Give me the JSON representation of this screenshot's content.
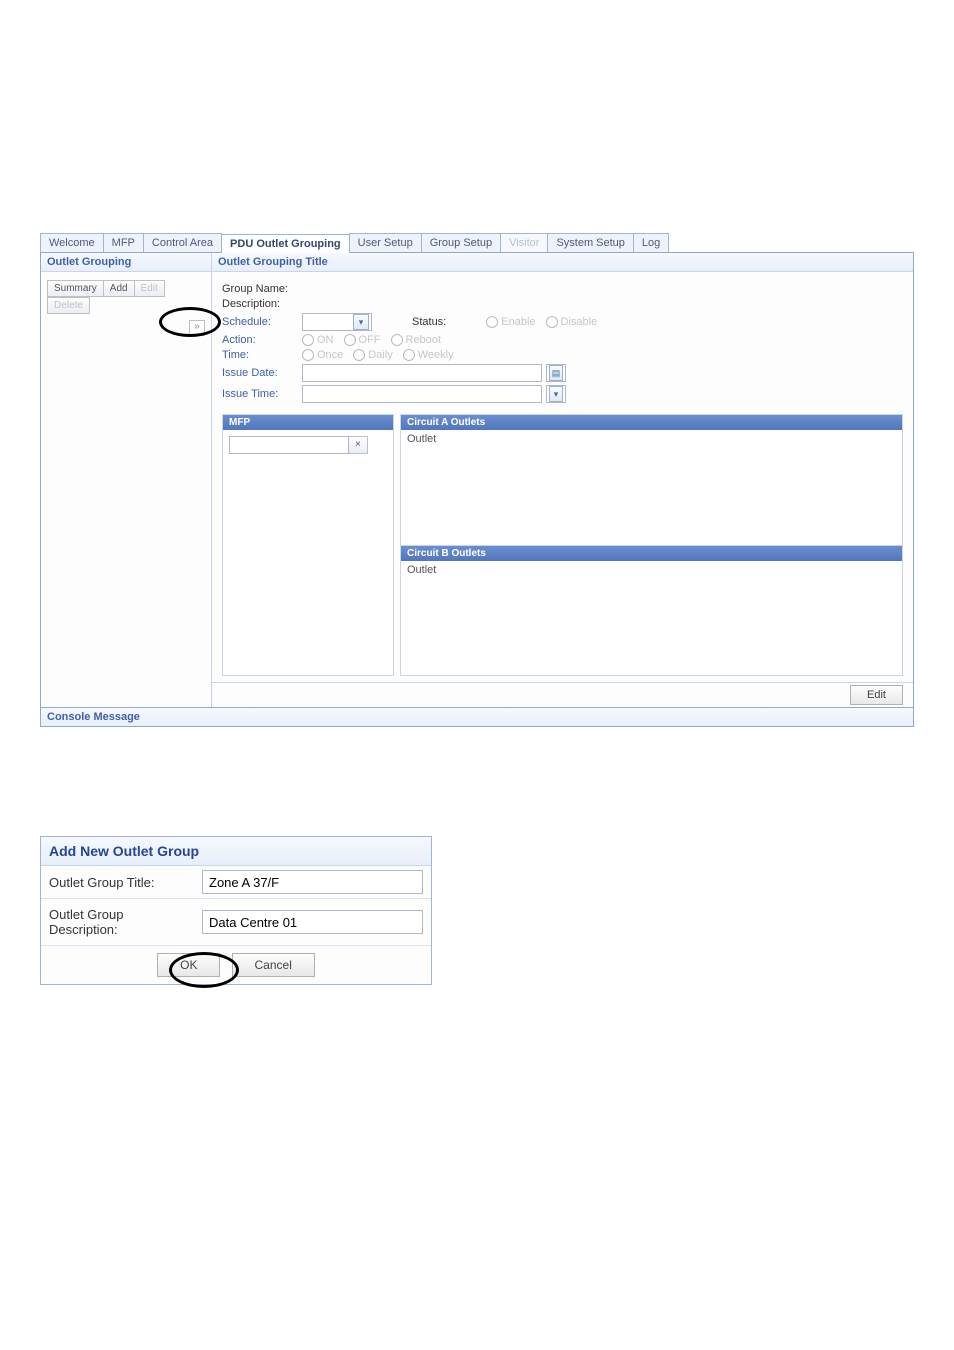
{
  "tabs": {
    "welcome": "Welcome",
    "mfp": "MFP",
    "control_area": "Control Area",
    "pdu_outlet_grouping": "PDU Outlet Grouping",
    "user_setup": "User Setup",
    "group_setup": "Group Setup",
    "visitor": "Visitor",
    "system_setup": "System Setup",
    "log": "Log"
  },
  "sidebar": {
    "title": "Outlet Grouping",
    "buttons": {
      "summary": "Summary",
      "add": "Add",
      "edit": "Edit",
      "delete": "Delete"
    },
    "expander": "»"
  },
  "form": {
    "title": "Outlet Grouping Title",
    "labels": {
      "group_name": "Group Name:",
      "description": "Description:",
      "schedule": "Schedule:",
      "status": "Status:",
      "action": "Action:",
      "time": "Time:",
      "issue_date": "Issue Date:",
      "issue_time": "Issue Time:"
    },
    "radios": {
      "enable": "Enable",
      "disable": "Disable",
      "on": "ON",
      "off": "OFF",
      "reboot": "Reboot",
      "once": "Once",
      "daily": "Daily",
      "weekly": "Weekly"
    }
  },
  "sub": {
    "mfp": "MFP",
    "mfp_clear": "×",
    "circuit_a": "Circuit A Outlets",
    "circuit_b": "Circuit B Outlets",
    "outlet": "Outlet"
  },
  "buttons": {
    "edit": "Edit"
  },
  "console": {
    "title": "Console Message"
  },
  "dialog": {
    "title": "Add New Outlet Group",
    "labels": {
      "title": "Outlet Group Title:",
      "description": "Outlet Group Description:"
    },
    "values": {
      "title": "Zone A 37/F",
      "description": "Data Centre 01"
    },
    "buttons": {
      "ok": "OK",
      "cancel": "Cancel"
    }
  }
}
